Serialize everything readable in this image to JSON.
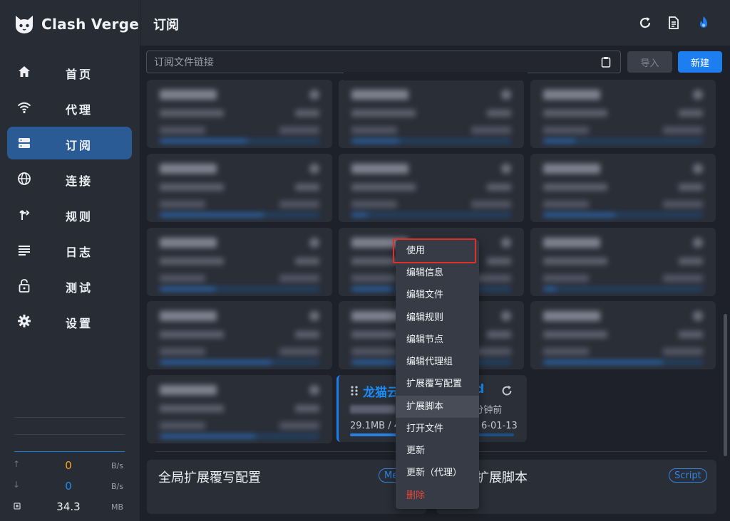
{
  "brand": {
    "name": "Clash Verge"
  },
  "sidebar": {
    "items": [
      {
        "label": "首页",
        "icon": "home-icon"
      },
      {
        "label": "代理",
        "icon": "wifi-icon"
      },
      {
        "label": "订阅",
        "icon": "server-icon",
        "active": true
      },
      {
        "label": "连接",
        "icon": "globe-icon"
      },
      {
        "label": "规则",
        "icon": "fork-icon"
      },
      {
        "label": "日志",
        "icon": "lines-icon"
      },
      {
        "label": "测试",
        "icon": "lock-icon"
      },
      {
        "label": "设置",
        "icon": "gear-icon"
      }
    ],
    "traffic": {
      "upload": {
        "value": "0",
        "unit": "B/s",
        "color": "#f5a623"
      },
      "download": {
        "value": "0",
        "unit": "B/s",
        "color": "#1d8df5"
      },
      "memory": {
        "value": "34.3",
        "unit": "MB"
      }
    }
  },
  "header": {
    "title": "订阅"
  },
  "toolbar": {
    "url_placeholder": "订阅文件链接",
    "import_label": "导入",
    "new_label": "新建"
  },
  "selected_profile": {
    "title_start": "龙猫云",
    "title_end": "ud",
    "updated_ago": "5 分钟前",
    "usage": "29.1MB / 4",
    "expire": "6-01-13"
  },
  "bottom": {
    "merge_title": "全局扩展覆写配置",
    "merge_chip": "Me",
    "script_title": "扩展脚本",
    "script_chip": "Script"
  },
  "context_menu": {
    "items": [
      {
        "label": "使用"
      },
      {
        "label": "编辑信息"
      },
      {
        "label": "编辑文件"
      },
      {
        "label": "编辑规则"
      },
      {
        "label": "编辑节点"
      },
      {
        "label": "编辑代理组"
      },
      {
        "label": "扩展覆写配置"
      },
      {
        "label": "扩展脚本"
      },
      {
        "label": "打开文件"
      },
      {
        "label": "更新"
      },
      {
        "label": "更新（代理）"
      },
      {
        "label": "删除"
      }
    ]
  },
  "colors": {
    "accent": "#1d7ef0",
    "highlight": "#e0302a",
    "danger": "#e1463a"
  }
}
